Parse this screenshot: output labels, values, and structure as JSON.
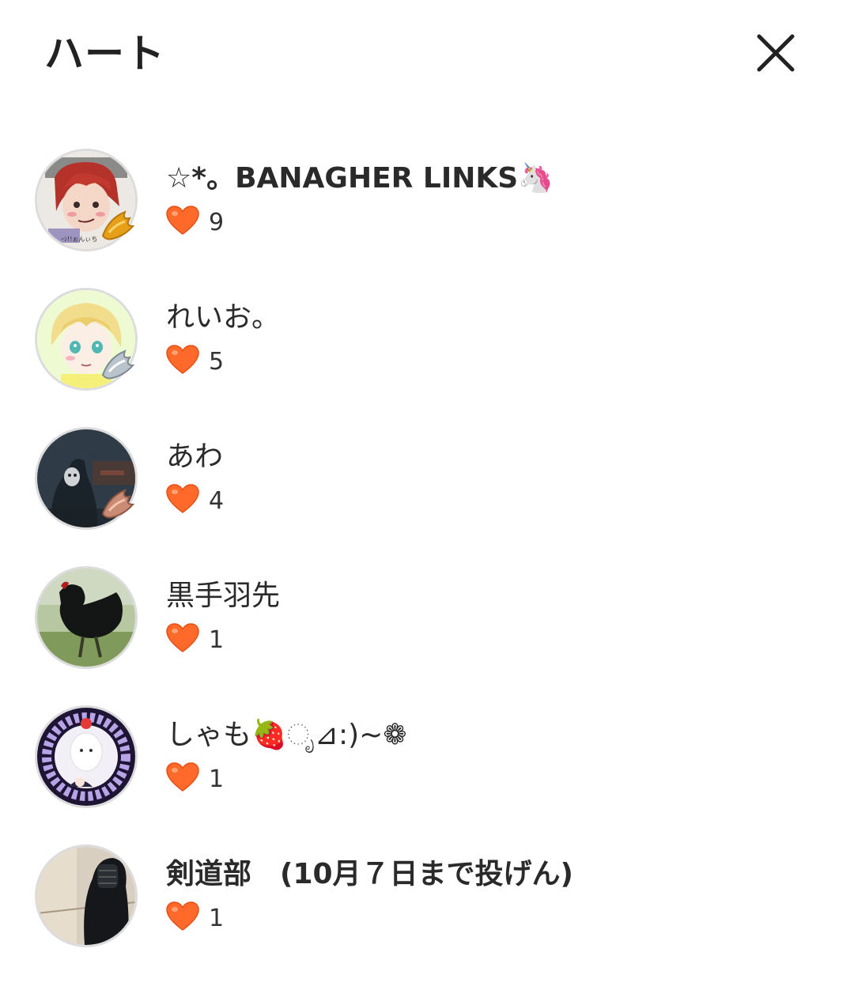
{
  "header": {
    "title": "ハート",
    "close_icon": "close-icon"
  },
  "colors": {
    "heart": "#ff6a2a",
    "heart_dark": "#e94f12",
    "text": "#2a2a2a",
    "avatar_border": "#dcdcdc"
  },
  "items": [
    {
      "name": "☆*。BANAGHER LINKS🦄",
      "count": "9",
      "badge": "gold-wing-badge",
      "avatar": "anime-drawing-red-hair"
    },
    {
      "name": "れいお。",
      "count": "5",
      "badge": "silver-wing-badge",
      "avatar": "anime-drawing-blonde"
    },
    {
      "name": "あわ",
      "count": "4",
      "badge": "bronze-wing-badge",
      "avatar": "hooded-figure-dark"
    },
    {
      "name": "黒手羽先",
      "count": "1",
      "badge": "",
      "avatar": "black-rooster-photo"
    },
    {
      "name": "しゃも🍓ೃ⊿:)~❁",
      "count": "1",
      "badge": "",
      "avatar": "purple-frame-character"
    },
    {
      "name": "剣道部　(10月７日まで投げん)",
      "count": "1",
      "badge": "",
      "avatar": "kendo-photo"
    }
  ]
}
